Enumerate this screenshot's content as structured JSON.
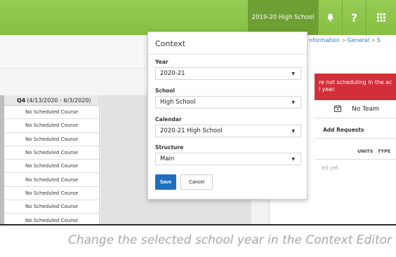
{
  "topbar": {
    "school_year": "2019-20 High School",
    "icons": [
      "bell-icon",
      "help-icon",
      "apps-grid-icon"
    ],
    "bg_color": "#8cc34a"
  },
  "breadcrumb": [
    "nformation",
    "General",
    "S"
  ],
  "alert": {
    "line1": "re not scheduling in the ac",
    "line2": "l year.",
    "color": "#d32f3a"
  },
  "team": {
    "value": "No Team"
  },
  "requests": {
    "add_label": "Add Requests"
  },
  "request_columns": {
    "units": "UNITS",
    "type": "TYPE"
  },
  "empty_note": "ed yet.",
  "schedule": {
    "header_term": "Q4",
    "header_range": "(4/13/2020 - 6/3/2020)",
    "rows": [
      "No Scheduled Course",
      "No Scheduled Course",
      "No Scheduled Course",
      "No Scheduled Course",
      "No Scheduled Course",
      "No Scheduled Course",
      "No Scheduled Course",
      "No Scheduled Course",
      "No Scheduled Course"
    ]
  },
  "context": {
    "title": "Context",
    "year": {
      "label": "Year",
      "value": "2020-21"
    },
    "school": {
      "label": "School",
      "value": "High School"
    },
    "calendar": {
      "label": "Calendar",
      "value": "2020-21 High School"
    },
    "structure": {
      "label": "Structure",
      "value": "Main"
    },
    "save_label": "Save",
    "cancel_label": "Cancel",
    "save_color": "#1f6fbf"
  },
  "caption": "Change the selected school year in the Context Editor"
}
